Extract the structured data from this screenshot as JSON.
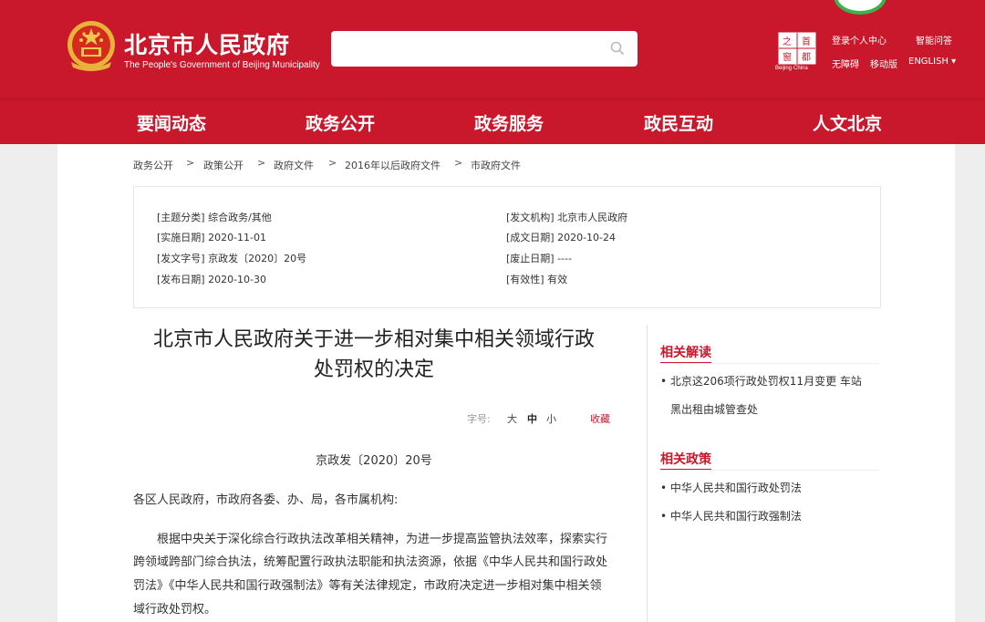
{
  "header": {
    "title": "北京市人民政府",
    "subtitle": "The People's Government of Beijing Municipality",
    "search_placeholder": "",
    "capital_logo_caption": "Beijing·China",
    "links": {
      "login": "登录个人中心",
      "smart_qa": "智能问答",
      "accessibility": "无障碍",
      "mobile": "移动版",
      "english": "ENGLISH ▾"
    },
    "colors": {
      "brand": "#c9182b",
      "accent_green": "#3bb34a"
    }
  },
  "nav": {
    "items": [
      "要闻动态",
      "政务公开",
      "政务服务",
      "政民互动",
      "人文北京"
    ]
  },
  "breadcrumb": {
    "items": [
      "政务公开",
      "政策公开",
      "政府文件",
      "2016年以后政府文件",
      "市政府文件"
    ],
    "separator": ">"
  },
  "meta": {
    "topic": "[主题分类] 综合政务/其他",
    "effective": "[实施日期] 2020-11-01",
    "doc_no": "[发文字号] 京政发〔2020〕20号",
    "published": "[发布日期] 2020-10-30",
    "issuer": "[发文机构] 北京市人民政府",
    "created": "[成文日期] 2020-10-24",
    "repealed": "[废止日期] ----",
    "validity": "[有效性] 有效"
  },
  "article": {
    "title_line1": "北京市人民政府关于进一步相对集中相关领域行政",
    "title_line2": "处罚权的决定",
    "font_size_label": "字号:",
    "font_large": "大",
    "font_medium": "中",
    "font_small": "小",
    "favorite": "收藏",
    "doc_number": "京政发〔2020〕20号",
    "greeting": "各区人民政府，市政府各委、办、局，各市属机构:",
    "body_lines": [
      "根据中央关于深化综合行政执法改革相关精神，为进一步提高监管执法效率，探索实行",
      "跨领域跨部门综合执法，统筹配置行政执法职能和执法资源，依据《中华人民共和国行政处",
      "罚法》《中华人民共和国行政强制法》等有关法律规定，市政府决定进一步相对集中相关领",
      "域行政处罚权。"
    ]
  },
  "sidebar": {
    "related_reading_title": "相关解读",
    "related_reading": [
      {
        "line1": "• 北京这206项行政处罚权11月变更 车站",
        "line2": "黑出租由城管查处"
      }
    ],
    "related_policy_title": "相关政策",
    "related_policy": [
      "• 中华人民共和国行政处罚法",
      "• 中华人民共和国行政强制法"
    ]
  }
}
